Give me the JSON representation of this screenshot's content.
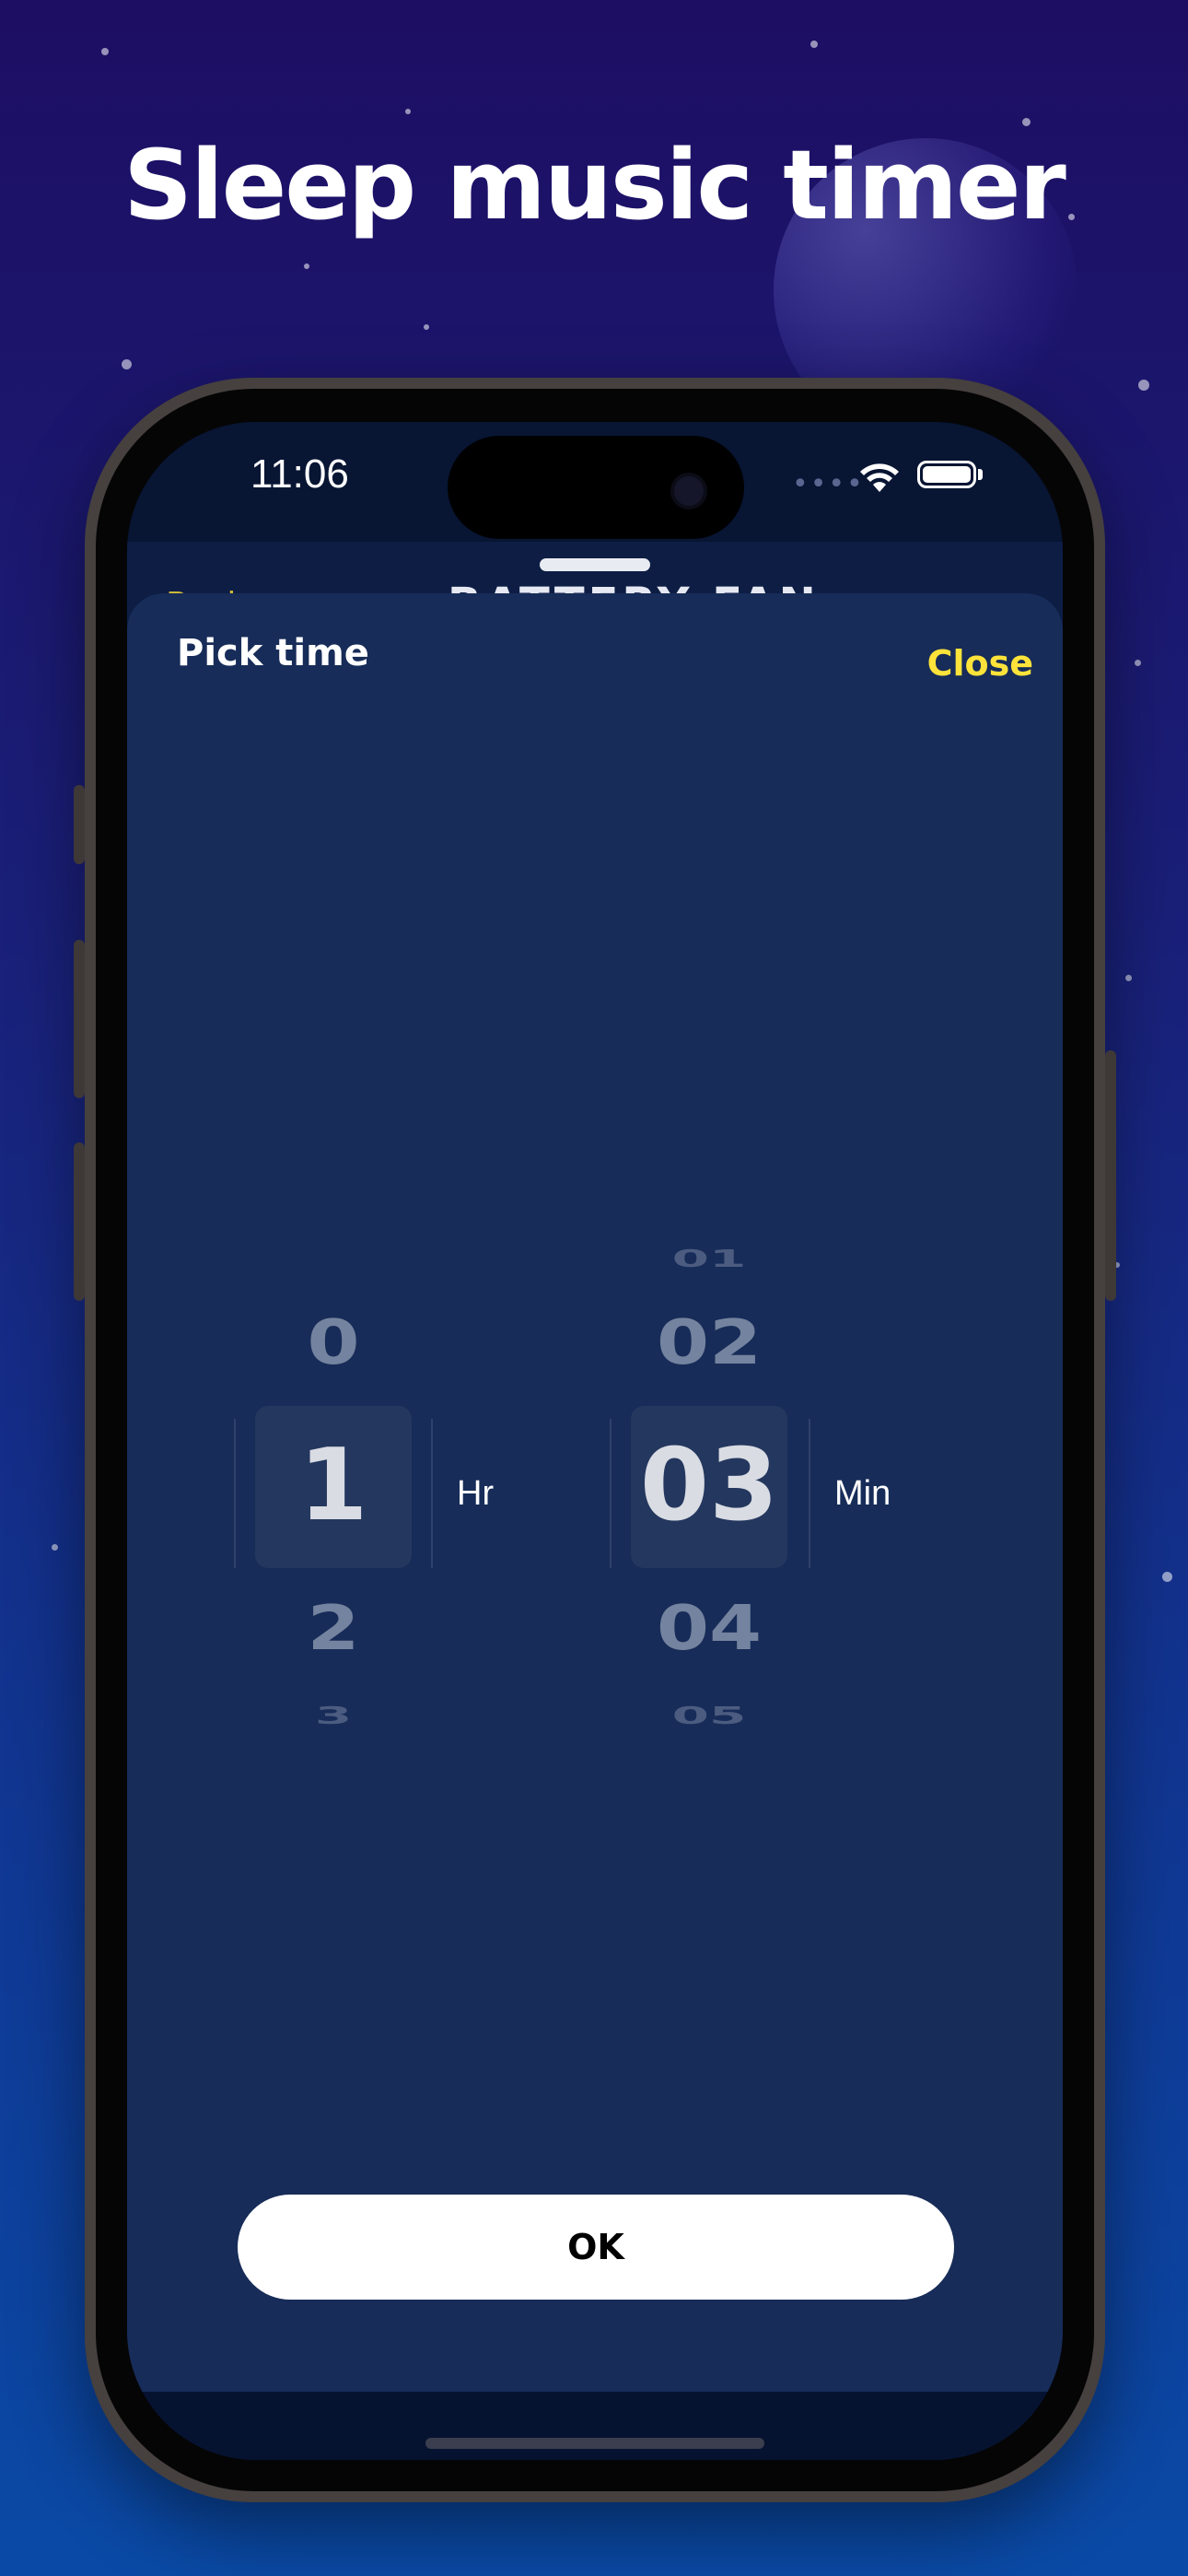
{
  "headline": "Sleep music timer",
  "status_bar": {
    "time": "11:06"
  },
  "background_screen": {
    "title": "BATTERY FAN",
    "back": "Back"
  },
  "sheet": {
    "title": "Pick time",
    "close_label": "Close",
    "ok_label": "OK"
  },
  "hours_picker": {
    "unit": "Hr",
    "items": [
      "0",
      "1",
      "2",
      "3"
    ],
    "selected": "1"
  },
  "minutes_picker": {
    "unit": "Min",
    "items": [
      "01",
      "02",
      "03",
      "04",
      "05"
    ],
    "selected": "03"
  },
  "colors": {
    "accent": "#ffe33a",
    "sheet_bg": "#172c58",
    "selected_box": "#24375e"
  }
}
